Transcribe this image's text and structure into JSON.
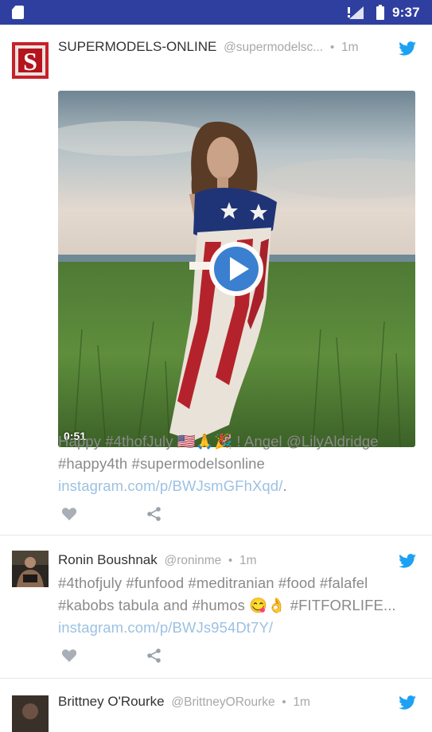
{
  "status_bar": {
    "time": "9:37"
  },
  "colors": {
    "status_bar": "#2f3fa0",
    "twitter_blue": "#1da1f2",
    "link": "#9cc1e3",
    "text_muted": "#8a8a8a"
  },
  "tweets": [
    {
      "name": "SUPERMODELS-ONLINE",
      "handle": "@supermodelsc...",
      "separator": "•",
      "time": "1m",
      "text_plain": "Happy #4thofJuly 🇺🇸🙏🎉 ! Angel @LilyAldridge #happy4th #supermodelsonline ",
      "link": "instagram.com/p/BWJsmGFhXqd/",
      "text_end": ".",
      "media": {
        "duration": "0:51"
      },
      "avatar_letter": "S",
      "icons": [
        "twitter-bird-icon",
        "heart-icon",
        "share-icon",
        "play-icon"
      ]
    },
    {
      "name": "Ronin Boushnak",
      "handle": "@roninme",
      "separator": "•",
      "time": "1m",
      "text_plain": "#4thofjuly #funfood #meditranian #food #falafel #kabobs tabula and #humos 😋👌 #FITFORLIFE... ",
      "link": "instagram.com/p/BWJs954Dt7Y/",
      "icons": [
        "twitter-bird-icon",
        "heart-icon",
        "share-icon"
      ]
    },
    {
      "name": "Brittney O'Rourke",
      "handle": "@BrittneyORourke",
      "separator": "•",
      "time": "1m",
      "icons": [
        "twitter-bird-icon"
      ]
    }
  ]
}
